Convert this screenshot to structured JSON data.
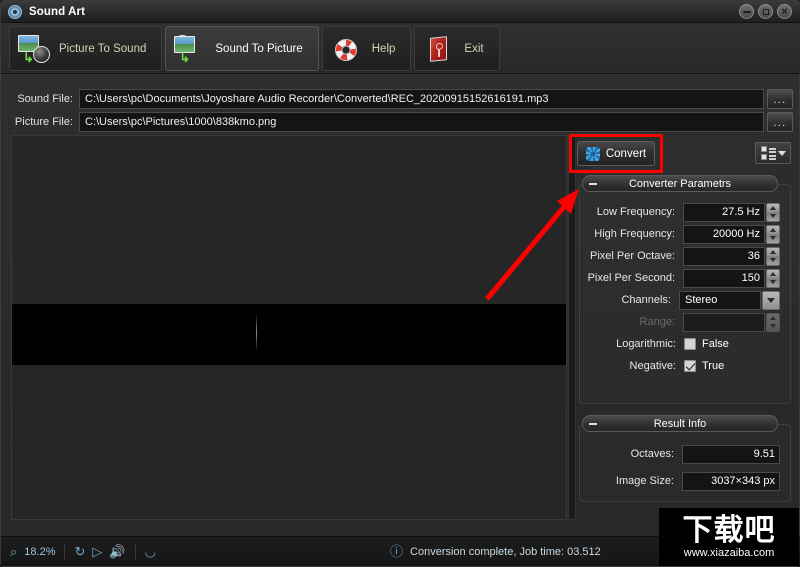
{
  "window": {
    "title": "Sound Art",
    "icon": "app-gear-icon",
    "minimize_label": "—",
    "maximize_label": "⬜",
    "close_label": "✕"
  },
  "toolbar": {
    "tabs": [
      {
        "label": "Picture To Sound",
        "icon": "picture-to-sound-icon",
        "active": false
      },
      {
        "label": "Sound To Picture",
        "icon": "sound-to-picture-icon",
        "active": true
      },
      {
        "label": "Help",
        "icon": "life-ring-icon",
        "active": false
      },
      {
        "label": "Exit",
        "icon": "exit-door-icon",
        "active": false
      }
    ]
  },
  "files": {
    "sound": {
      "label": "Sound File:",
      "value": "C:\\Users\\pc\\Documents\\Joyoshare Audio Recorder\\Converted\\REC_20200915152616191.mp3",
      "browse_label": "..."
    },
    "picture": {
      "label": "Picture File:",
      "value": "C:\\Users\\pc\\Pictures\\1000\\838kmo.png",
      "browse_label": "..."
    }
  },
  "actions": {
    "convert_label": "Convert",
    "convert_icon": "gear-icon",
    "view_toggle_icon": "list-view-dropdown-icon",
    "highlight_color": "#ff0000",
    "annotation_arrow_color": "#ff0000"
  },
  "converter_parameters": {
    "title": "Converter Parametrs",
    "collapse_label": "–",
    "rows": [
      {
        "label": "Low Frequency:",
        "value": "27.5 Hz",
        "control": "spinner",
        "disabled": false
      },
      {
        "label": "High Frequency:",
        "value": "20000 Hz",
        "control": "spinner",
        "disabled": false
      },
      {
        "label": "Pixel Per Octave:",
        "value": "36",
        "control": "spinner",
        "disabled": false
      },
      {
        "label": "Pixel Per Second:",
        "value": "150",
        "control": "spinner",
        "disabled": false
      },
      {
        "label": "Channels:",
        "value": "Stereo",
        "control": "dropdown",
        "disabled": false
      },
      {
        "label": "Range:",
        "value": "",
        "control": "spinner",
        "disabled": true
      }
    ],
    "checkboxes": [
      {
        "label": "Logarithmic:",
        "value": "False",
        "checked": false
      },
      {
        "label": "Negative:",
        "value": "True",
        "checked": true
      }
    ]
  },
  "result_info": {
    "title": "Result Info",
    "collapse_label": "–",
    "rows": [
      {
        "label": "Octaves:",
        "value": "9.51"
      },
      {
        "label": "Image Size:",
        "value": "3037×343 px"
      }
    ]
  },
  "statusbar": {
    "zoom_icon": "magnifier-icon",
    "zoom_value": "18.2%",
    "buttons": [
      {
        "icon": "refresh-icon",
        "glyph": "↻"
      },
      {
        "icon": "play-icon",
        "glyph": "▷"
      },
      {
        "icon": "speaker-icon",
        "glyph": "🔊"
      },
      {
        "icon": "comment-icon",
        "glyph": "○"
      }
    ],
    "message_icon": "info-icon",
    "message": "Conversion complete, Job time: 03.512"
  },
  "watermark": {
    "text_cn": "下载吧",
    "url": "www.xiazaiba.com"
  }
}
